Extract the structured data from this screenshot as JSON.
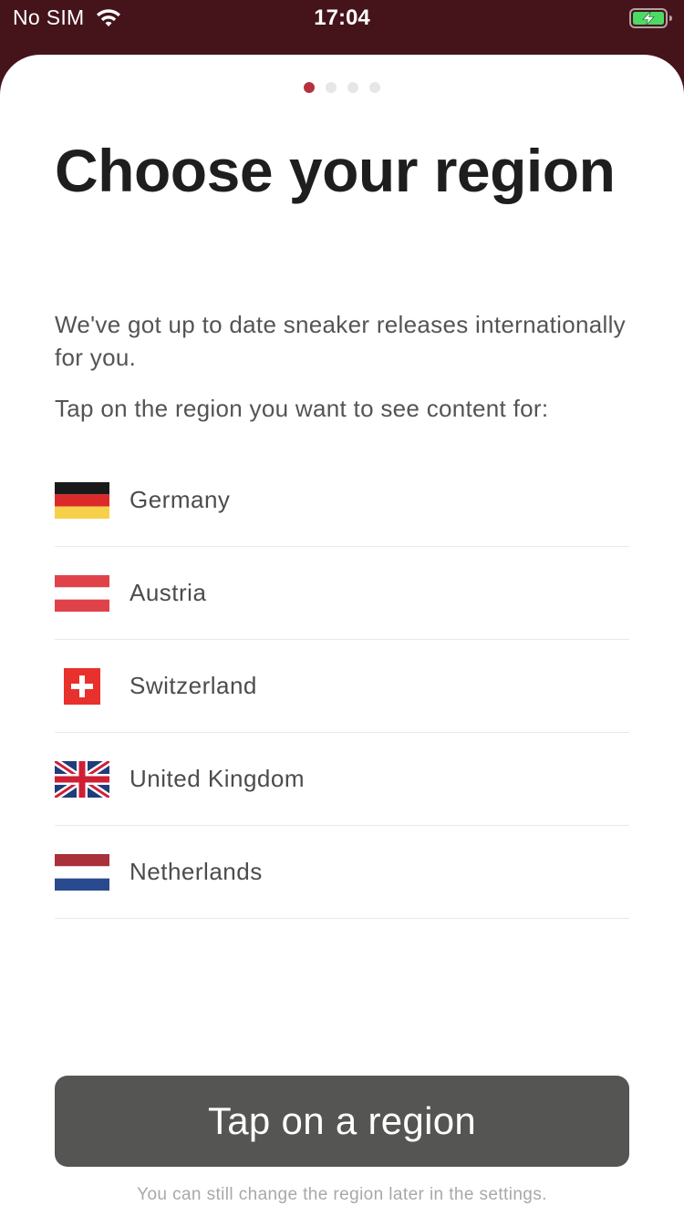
{
  "status_bar": {
    "carrier": "No SIM",
    "time": "17:04"
  },
  "pagination": {
    "total": 4,
    "active_index": 0,
    "active_color": "#b5323d"
  },
  "header": {
    "title": "Choose your region",
    "intro": "We've got up to date sneaker releases internationally for you.",
    "instruction": "Tap on the region you want to see content for:"
  },
  "regions": [
    {
      "label": "Germany",
      "flag": "germany-flag-icon"
    },
    {
      "label": "Austria",
      "flag": "austria-flag-icon"
    },
    {
      "label": "Switzerland",
      "flag": "switzerland-flag-icon"
    },
    {
      "label": "United Kingdom",
      "flag": "uk-flag-icon"
    },
    {
      "label": "Netherlands",
      "flag": "netherlands-flag-icon"
    }
  ],
  "cta": {
    "label": "Tap on a region"
  },
  "footnote": "You can still change the region later in the settings.",
  "colors": {
    "status_bar_bg": "#45141b",
    "button_bg": "#555553",
    "battery_green": "#4cd964"
  }
}
